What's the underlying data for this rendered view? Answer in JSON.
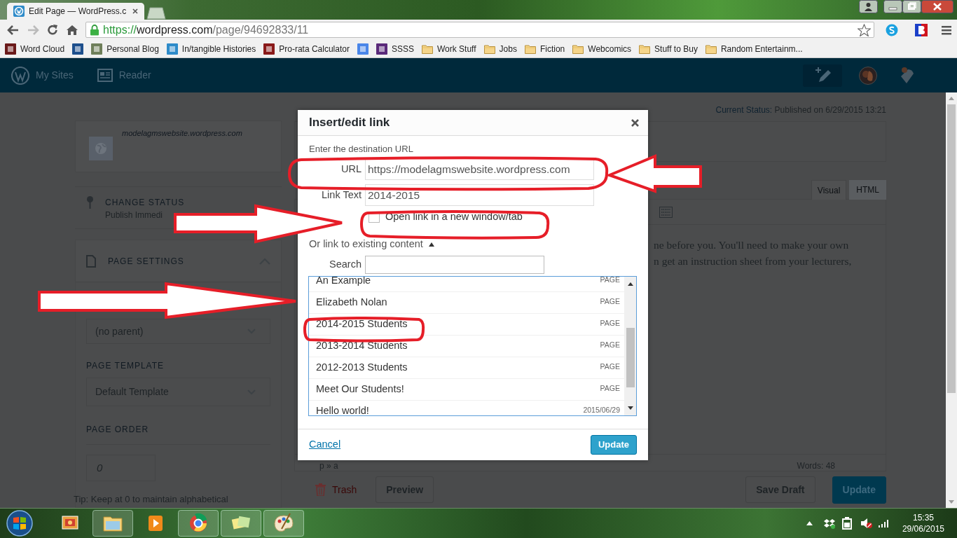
{
  "browser": {
    "tab_title": "Edit Page — WordPress.c",
    "url": {
      "scheme": "https://",
      "host": "wordpress.com",
      "path": "/page/94692833/11"
    },
    "bookmarks": [
      {
        "label": "Word Cloud",
        "kind": "site",
        "color": "#6b1a1a"
      },
      {
        "kind": "site",
        "color": "#1d4f8c"
      },
      {
        "label": "Personal Blog",
        "kind": "site",
        "color": "#6f7f5a"
      },
      {
        "label": "In/tangible Histories",
        "kind": "site",
        "color": "#2e8bc9"
      },
      {
        "label": "Pro-rata Calculator",
        "kind": "site",
        "color": "#8a1a1a"
      },
      {
        "kind": "site",
        "color": "#4a86e8"
      },
      {
        "label": "SSSS",
        "kind": "site",
        "color": "#5a2a7a"
      },
      {
        "label": "Work Stuff",
        "kind": "folder"
      },
      {
        "label": "Jobs",
        "kind": "folder"
      },
      {
        "label": "Fiction",
        "kind": "folder"
      },
      {
        "label": "Webcomics",
        "kind": "folder"
      },
      {
        "label": "Stuff to Buy",
        "kind": "folder"
      },
      {
        "label": "Random Entertainm...",
        "kind": "folder"
      }
    ]
  },
  "masterbar": {
    "items": [
      {
        "label": "My Sites",
        "kind": "sites"
      },
      {
        "label": "Reader",
        "kind": "reader"
      }
    ]
  },
  "sidebar": {
    "site_url": "modelagmswebsite.wordpress.com",
    "change_status": {
      "label": "CHANGE STATUS",
      "value": "Publish Immedi"
    },
    "page_settings": {
      "title": "PAGE SETTINGS",
      "expanded": true,
      "parent": "(no parent)",
      "template_label": "PAGE TEMPLATE",
      "template": "Default Template",
      "order_label": "PAGE ORDER",
      "order": "0",
      "tip": "Tip: Keep at 0 to maintain alphabetical"
    }
  },
  "editor": {
    "status_label": "Current Status:",
    "status_value": "Published on 6/29/2015 13:21",
    "tabs": [
      {
        "label": "Visual",
        "selected": true
      },
      {
        "label": "HTML",
        "selected": false
      }
    ],
    "content_lines": [
      "ne before you. You'll need to make your own",
      "n get an instruction sheet from your lecturers,"
    ],
    "path": "p » a",
    "word_count": "Words: 48",
    "actions": [
      {
        "label": "Trash",
        "kind": "trash"
      },
      {
        "label": "Preview",
        "kind": "secondary"
      },
      {
        "label": "Save Draft",
        "kind": "secondary"
      },
      {
        "label": "Update",
        "kind": "primary"
      }
    ]
  },
  "dialog": {
    "title": "Insert/edit link",
    "hint": "Enter the destination URL",
    "fields": [
      {
        "label": "URL",
        "value": "https://modelagmswebsite.wordpress.com"
      },
      {
        "label": "Link Text",
        "value": "2014-2015"
      }
    ],
    "new_tab": {
      "label": "Open link in a new window/tab",
      "checked": false
    },
    "existing": {
      "label": "Or link to existing content",
      "expanded": true
    },
    "search_label": "Search",
    "results": [
      {
        "title": "An Example",
        "info": "PAGE"
      },
      {
        "title": "Elizabeth Nolan",
        "info": "PAGE"
      },
      {
        "title": "2014-2015 Students",
        "info": "PAGE"
      },
      {
        "title": "2013-2014 Students",
        "info": "PAGE"
      },
      {
        "title": "2012-2013 Students",
        "info": "PAGE"
      },
      {
        "title": "Meet Our Students!",
        "info": "PAGE"
      },
      {
        "title": "Hello world!",
        "info": "2015/06/29"
      }
    ],
    "cancel": "Cancel",
    "submit": "Update"
  },
  "taskbar": {
    "apps": [
      {
        "kind": "gallery",
        "running": false
      },
      {
        "kind": "explorer",
        "running": true
      },
      {
        "kind": "player",
        "running": false
      },
      {
        "kind": "chrome",
        "running": true
      },
      {
        "kind": "notes",
        "running": true
      },
      {
        "kind": "paint",
        "running": true
      }
    ],
    "time": "15:35",
    "date": "29/06/2015"
  }
}
